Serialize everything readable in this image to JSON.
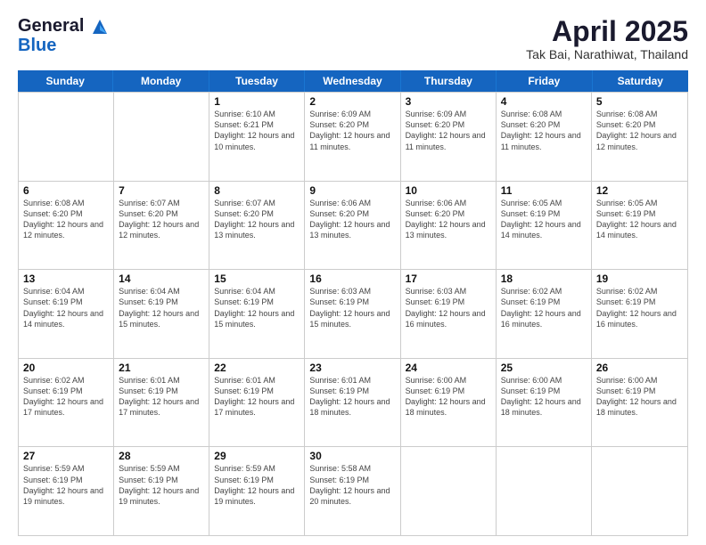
{
  "header": {
    "logo_line1": "General",
    "logo_line2": "Blue",
    "month": "April 2025",
    "location": "Tak Bai, Narathiwat, Thailand"
  },
  "days_of_week": [
    "Sunday",
    "Monday",
    "Tuesday",
    "Wednesday",
    "Thursday",
    "Friday",
    "Saturday"
  ],
  "weeks": [
    [
      {
        "day": "",
        "info": ""
      },
      {
        "day": "",
        "info": ""
      },
      {
        "day": "1",
        "info": "Sunrise: 6:10 AM\nSunset: 6:21 PM\nDaylight: 12 hours and 10 minutes."
      },
      {
        "day": "2",
        "info": "Sunrise: 6:09 AM\nSunset: 6:20 PM\nDaylight: 12 hours and 11 minutes."
      },
      {
        "day": "3",
        "info": "Sunrise: 6:09 AM\nSunset: 6:20 PM\nDaylight: 12 hours and 11 minutes."
      },
      {
        "day": "4",
        "info": "Sunrise: 6:08 AM\nSunset: 6:20 PM\nDaylight: 12 hours and 11 minutes."
      },
      {
        "day": "5",
        "info": "Sunrise: 6:08 AM\nSunset: 6:20 PM\nDaylight: 12 hours and 12 minutes."
      }
    ],
    [
      {
        "day": "6",
        "info": "Sunrise: 6:08 AM\nSunset: 6:20 PM\nDaylight: 12 hours and 12 minutes."
      },
      {
        "day": "7",
        "info": "Sunrise: 6:07 AM\nSunset: 6:20 PM\nDaylight: 12 hours and 12 minutes."
      },
      {
        "day": "8",
        "info": "Sunrise: 6:07 AM\nSunset: 6:20 PM\nDaylight: 12 hours and 13 minutes."
      },
      {
        "day": "9",
        "info": "Sunrise: 6:06 AM\nSunset: 6:20 PM\nDaylight: 12 hours and 13 minutes."
      },
      {
        "day": "10",
        "info": "Sunrise: 6:06 AM\nSunset: 6:20 PM\nDaylight: 12 hours and 13 minutes."
      },
      {
        "day": "11",
        "info": "Sunrise: 6:05 AM\nSunset: 6:19 PM\nDaylight: 12 hours and 14 minutes."
      },
      {
        "day": "12",
        "info": "Sunrise: 6:05 AM\nSunset: 6:19 PM\nDaylight: 12 hours and 14 minutes."
      }
    ],
    [
      {
        "day": "13",
        "info": "Sunrise: 6:04 AM\nSunset: 6:19 PM\nDaylight: 12 hours and 14 minutes."
      },
      {
        "day": "14",
        "info": "Sunrise: 6:04 AM\nSunset: 6:19 PM\nDaylight: 12 hours and 15 minutes."
      },
      {
        "day": "15",
        "info": "Sunrise: 6:04 AM\nSunset: 6:19 PM\nDaylight: 12 hours and 15 minutes."
      },
      {
        "day": "16",
        "info": "Sunrise: 6:03 AM\nSunset: 6:19 PM\nDaylight: 12 hours and 15 minutes."
      },
      {
        "day": "17",
        "info": "Sunrise: 6:03 AM\nSunset: 6:19 PM\nDaylight: 12 hours and 16 minutes."
      },
      {
        "day": "18",
        "info": "Sunrise: 6:02 AM\nSunset: 6:19 PM\nDaylight: 12 hours and 16 minutes."
      },
      {
        "day": "19",
        "info": "Sunrise: 6:02 AM\nSunset: 6:19 PM\nDaylight: 12 hours and 16 minutes."
      }
    ],
    [
      {
        "day": "20",
        "info": "Sunrise: 6:02 AM\nSunset: 6:19 PM\nDaylight: 12 hours and 17 minutes."
      },
      {
        "day": "21",
        "info": "Sunrise: 6:01 AM\nSunset: 6:19 PM\nDaylight: 12 hours and 17 minutes."
      },
      {
        "day": "22",
        "info": "Sunrise: 6:01 AM\nSunset: 6:19 PM\nDaylight: 12 hours and 17 minutes."
      },
      {
        "day": "23",
        "info": "Sunrise: 6:01 AM\nSunset: 6:19 PM\nDaylight: 12 hours and 18 minutes."
      },
      {
        "day": "24",
        "info": "Sunrise: 6:00 AM\nSunset: 6:19 PM\nDaylight: 12 hours and 18 minutes."
      },
      {
        "day": "25",
        "info": "Sunrise: 6:00 AM\nSunset: 6:19 PM\nDaylight: 12 hours and 18 minutes."
      },
      {
        "day": "26",
        "info": "Sunrise: 6:00 AM\nSunset: 6:19 PM\nDaylight: 12 hours and 18 minutes."
      }
    ],
    [
      {
        "day": "27",
        "info": "Sunrise: 5:59 AM\nSunset: 6:19 PM\nDaylight: 12 hours and 19 minutes."
      },
      {
        "day": "28",
        "info": "Sunrise: 5:59 AM\nSunset: 6:19 PM\nDaylight: 12 hours and 19 minutes."
      },
      {
        "day": "29",
        "info": "Sunrise: 5:59 AM\nSunset: 6:19 PM\nDaylight: 12 hours and 19 minutes."
      },
      {
        "day": "30",
        "info": "Sunrise: 5:58 AM\nSunset: 6:19 PM\nDaylight: 12 hours and 20 minutes."
      },
      {
        "day": "",
        "info": ""
      },
      {
        "day": "",
        "info": ""
      },
      {
        "day": "",
        "info": ""
      }
    ]
  ]
}
